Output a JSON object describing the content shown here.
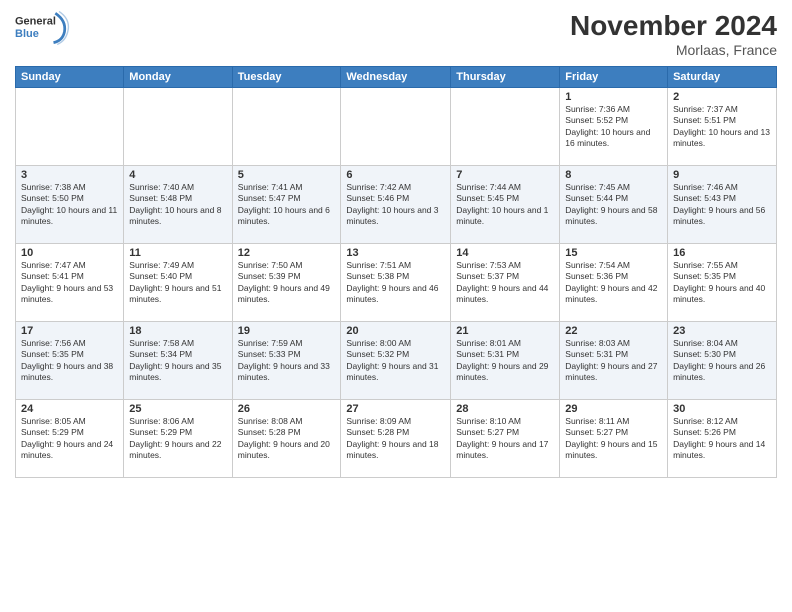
{
  "header": {
    "month_title": "November 2024",
    "location": "Morlaas, France"
  },
  "logo": {
    "line1": "General",
    "line2": "Blue"
  },
  "days_of_week": [
    "Sunday",
    "Monday",
    "Tuesday",
    "Wednesday",
    "Thursday",
    "Friday",
    "Saturday"
  ],
  "weeks": [
    [
      {
        "day": "",
        "info": ""
      },
      {
        "day": "",
        "info": ""
      },
      {
        "day": "",
        "info": ""
      },
      {
        "day": "",
        "info": ""
      },
      {
        "day": "",
        "info": ""
      },
      {
        "day": "1",
        "info": "Sunrise: 7:36 AM\nSunset: 5:52 PM\nDaylight: 10 hours and 16 minutes."
      },
      {
        "day": "2",
        "info": "Sunrise: 7:37 AM\nSunset: 5:51 PM\nDaylight: 10 hours and 13 minutes."
      }
    ],
    [
      {
        "day": "3",
        "info": "Sunrise: 7:38 AM\nSunset: 5:50 PM\nDaylight: 10 hours and 11 minutes."
      },
      {
        "day": "4",
        "info": "Sunrise: 7:40 AM\nSunset: 5:48 PM\nDaylight: 10 hours and 8 minutes."
      },
      {
        "day": "5",
        "info": "Sunrise: 7:41 AM\nSunset: 5:47 PM\nDaylight: 10 hours and 6 minutes."
      },
      {
        "day": "6",
        "info": "Sunrise: 7:42 AM\nSunset: 5:46 PM\nDaylight: 10 hours and 3 minutes."
      },
      {
        "day": "7",
        "info": "Sunrise: 7:44 AM\nSunset: 5:45 PM\nDaylight: 10 hours and 1 minute."
      },
      {
        "day": "8",
        "info": "Sunrise: 7:45 AM\nSunset: 5:44 PM\nDaylight: 9 hours and 58 minutes."
      },
      {
        "day": "9",
        "info": "Sunrise: 7:46 AM\nSunset: 5:43 PM\nDaylight: 9 hours and 56 minutes."
      }
    ],
    [
      {
        "day": "10",
        "info": "Sunrise: 7:47 AM\nSunset: 5:41 PM\nDaylight: 9 hours and 53 minutes."
      },
      {
        "day": "11",
        "info": "Sunrise: 7:49 AM\nSunset: 5:40 PM\nDaylight: 9 hours and 51 minutes."
      },
      {
        "day": "12",
        "info": "Sunrise: 7:50 AM\nSunset: 5:39 PM\nDaylight: 9 hours and 49 minutes."
      },
      {
        "day": "13",
        "info": "Sunrise: 7:51 AM\nSunset: 5:38 PM\nDaylight: 9 hours and 46 minutes."
      },
      {
        "day": "14",
        "info": "Sunrise: 7:53 AM\nSunset: 5:37 PM\nDaylight: 9 hours and 44 minutes."
      },
      {
        "day": "15",
        "info": "Sunrise: 7:54 AM\nSunset: 5:36 PM\nDaylight: 9 hours and 42 minutes."
      },
      {
        "day": "16",
        "info": "Sunrise: 7:55 AM\nSunset: 5:35 PM\nDaylight: 9 hours and 40 minutes."
      }
    ],
    [
      {
        "day": "17",
        "info": "Sunrise: 7:56 AM\nSunset: 5:35 PM\nDaylight: 9 hours and 38 minutes."
      },
      {
        "day": "18",
        "info": "Sunrise: 7:58 AM\nSunset: 5:34 PM\nDaylight: 9 hours and 35 minutes."
      },
      {
        "day": "19",
        "info": "Sunrise: 7:59 AM\nSunset: 5:33 PM\nDaylight: 9 hours and 33 minutes."
      },
      {
        "day": "20",
        "info": "Sunrise: 8:00 AM\nSunset: 5:32 PM\nDaylight: 9 hours and 31 minutes."
      },
      {
        "day": "21",
        "info": "Sunrise: 8:01 AM\nSunset: 5:31 PM\nDaylight: 9 hours and 29 minutes."
      },
      {
        "day": "22",
        "info": "Sunrise: 8:03 AM\nSunset: 5:31 PM\nDaylight: 9 hours and 27 minutes."
      },
      {
        "day": "23",
        "info": "Sunrise: 8:04 AM\nSunset: 5:30 PM\nDaylight: 9 hours and 26 minutes."
      }
    ],
    [
      {
        "day": "24",
        "info": "Sunrise: 8:05 AM\nSunset: 5:29 PM\nDaylight: 9 hours and 24 minutes."
      },
      {
        "day": "25",
        "info": "Sunrise: 8:06 AM\nSunset: 5:29 PM\nDaylight: 9 hours and 22 minutes."
      },
      {
        "day": "26",
        "info": "Sunrise: 8:08 AM\nSunset: 5:28 PM\nDaylight: 9 hours and 20 minutes."
      },
      {
        "day": "27",
        "info": "Sunrise: 8:09 AM\nSunset: 5:28 PM\nDaylight: 9 hours and 18 minutes."
      },
      {
        "day": "28",
        "info": "Sunrise: 8:10 AM\nSunset: 5:27 PM\nDaylight: 9 hours and 17 minutes."
      },
      {
        "day": "29",
        "info": "Sunrise: 8:11 AM\nSunset: 5:27 PM\nDaylight: 9 hours and 15 minutes."
      },
      {
        "day": "30",
        "info": "Sunrise: 8:12 AM\nSunset: 5:26 PM\nDaylight: 9 hours and 14 minutes."
      }
    ]
  ]
}
